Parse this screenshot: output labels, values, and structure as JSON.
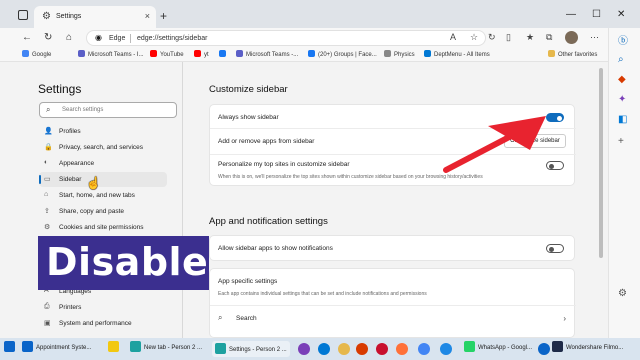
{
  "browser": {
    "tab_title": "Settings",
    "brand": "Edge",
    "url": "edge://settings/sidebar",
    "favorites": [
      {
        "label": "Google",
        "color": "#4285f4"
      },
      {
        "label": "Microsoft Teams - I...",
        "color": "#5b5fc7"
      },
      {
        "label": "YouTube",
        "color": "#ff0000"
      },
      {
        "label": "yt",
        "color": "#ff0000"
      },
      {
        "label": "",
        "color": "#1877f2"
      },
      {
        "label": "Microsoft Teams -...",
        "color": "#5b5fc7"
      },
      {
        "label": "(20+) Groups | Face...",
        "color": "#1877f2"
      },
      {
        "label": "Physics",
        "color": "#888888"
      },
      {
        "label": "DeptMenu - All Items",
        "color": "#0078d4"
      },
      {
        "label": "Other favorites",
        "color": "#e6b84c"
      }
    ]
  },
  "settings_nav": {
    "title": "Settings",
    "search_placeholder": "Search settings",
    "items": [
      {
        "label": "Profiles",
        "icon": "👤"
      },
      {
        "label": "Privacy, search, and services",
        "icon": "🔒"
      },
      {
        "label": "Appearance",
        "icon": "◐"
      },
      {
        "label": "Sidebar",
        "icon": "▭"
      },
      {
        "label": "Start, home, and new tabs",
        "icon": "⌂"
      },
      {
        "label": "Share, copy and paste",
        "icon": "⇪"
      },
      {
        "label": "Cookies and site permissions",
        "icon": "⚙"
      },
      {
        "label": "Languages",
        "icon": "A"
      },
      {
        "label": "Printers",
        "icon": "⎙"
      },
      {
        "label": "System and performance",
        "icon": "▣"
      }
    ]
  },
  "customize": {
    "heading": "Customize sidebar",
    "always_show_label": "Always show sidebar",
    "always_show_on": true,
    "add_remove_label": "Add or remove apps from sidebar",
    "customize_button": "Customize sidebar",
    "personalize_label": "Personalize my top sites in customize sidebar",
    "personalize_desc": "When this is on, we'll personalize the top sites shown within customize sidebar based on your browsing history/activities",
    "personalize_on": false
  },
  "app_notif": {
    "heading": "App and notification settings",
    "allow_label": "Allow sidebar apps to show notifications",
    "allow_on": false,
    "specific_label": "App specific settings",
    "specific_desc": "Each app contains individual settings that can be set and include notifications and permissions",
    "search_label": "Search"
  },
  "overlay": {
    "banner": "Disable",
    "arrow_color": "#e8232f",
    "banner_color": "#3b2f8f"
  },
  "taskbar": {
    "apps": [
      {
        "label": "Appointment Syste...",
        "color": "#0a64c8"
      },
      {
        "label": "New tab - Person 2 ...",
        "color": "#1da1a0"
      },
      {
        "label": "Settings - Person 2 ...",
        "color": "#1da1a0"
      },
      {
        "label": "WhatsApp - Googl...",
        "color": "#25d366"
      },
      {
        "label": "Wondershare Filmo...",
        "color": "#1e2a48"
      }
    ]
  }
}
